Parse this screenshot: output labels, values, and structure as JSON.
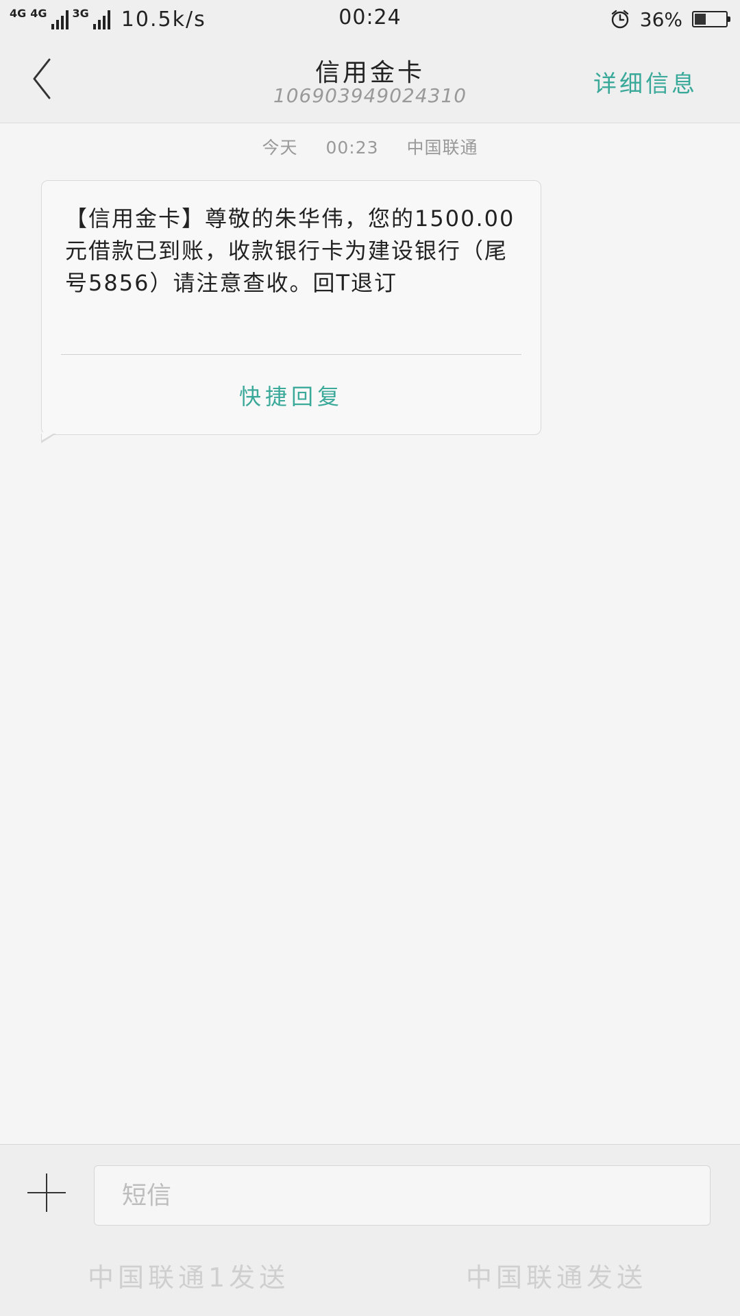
{
  "status_bar": {
    "network_1": "4G",
    "network_2": "4G",
    "network_3": "3G",
    "speed": "10.5k/s",
    "time": "00:24",
    "alarm_icon": "alarm-clock-icon",
    "battery_percent": "36%",
    "battery_level": 0.36
  },
  "header": {
    "back_icon": "chevron-left-icon",
    "title": "信用金卡",
    "number": "1069039490​24310",
    "details_label": "详细信息"
  },
  "conversation": {
    "day": "今天",
    "time": "00:23",
    "carrier": "中国联通",
    "message": "【信用金卡】尊敬的朱华伟，您的1500.00元借款已到账，收款银行卡为建设银行（尾号5856）请注意查收。回T退订",
    "quick_reply_label": "快捷回复"
  },
  "composer": {
    "plus_icon": "plus-icon",
    "placeholder": "短信",
    "send_sim1_label": "中国联通1发送",
    "send_sim2_label": "中国联通发送"
  },
  "colors": {
    "accent": "#3aa99a",
    "background": "#f5f5f5",
    "bar": "#efefef"
  }
}
